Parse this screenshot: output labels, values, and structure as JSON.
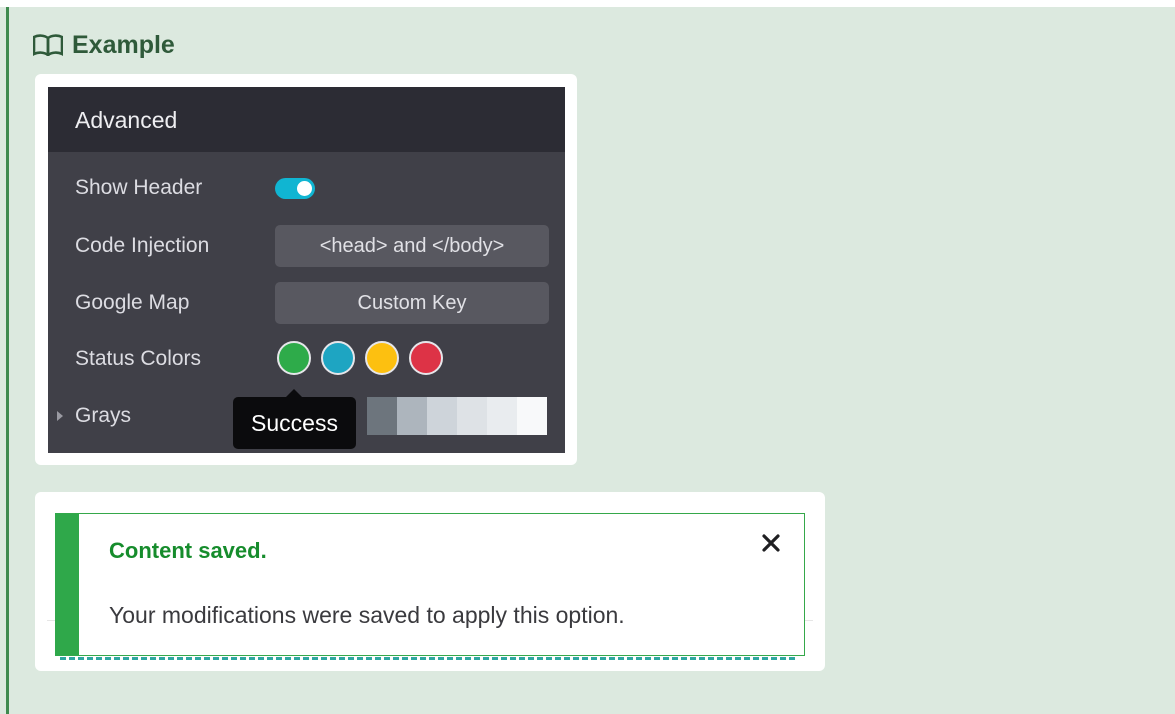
{
  "example": {
    "heading": "Example",
    "icon": "book-icon"
  },
  "settings": {
    "header": "Advanced",
    "rows": {
      "show_header": {
        "label": "Show Header",
        "enabled": true
      },
      "code_injection": {
        "label": "Code Injection",
        "button": "<head> and </body>"
      },
      "google_map": {
        "label": "Google Map",
        "button": "Custom Key"
      },
      "status_colors": {
        "label": "Status Colors",
        "swatches": [
          "#2eab4a",
          "#1ea5c2",
          "#fdc010",
          "#dd3346"
        ]
      },
      "grays": {
        "label": "Grays",
        "shades": [
          "#6d757d",
          "#adb5bd",
          "#ced4da",
          "#dee2e6",
          "#e9ecef",
          "#f8f9fa"
        ]
      }
    },
    "tooltip": "Success"
  },
  "notice": {
    "title": "Content saved.",
    "message": "Your modifications were saved to apply this option.",
    "close_icon": "close-icon",
    "accent": "#2fa84a"
  }
}
